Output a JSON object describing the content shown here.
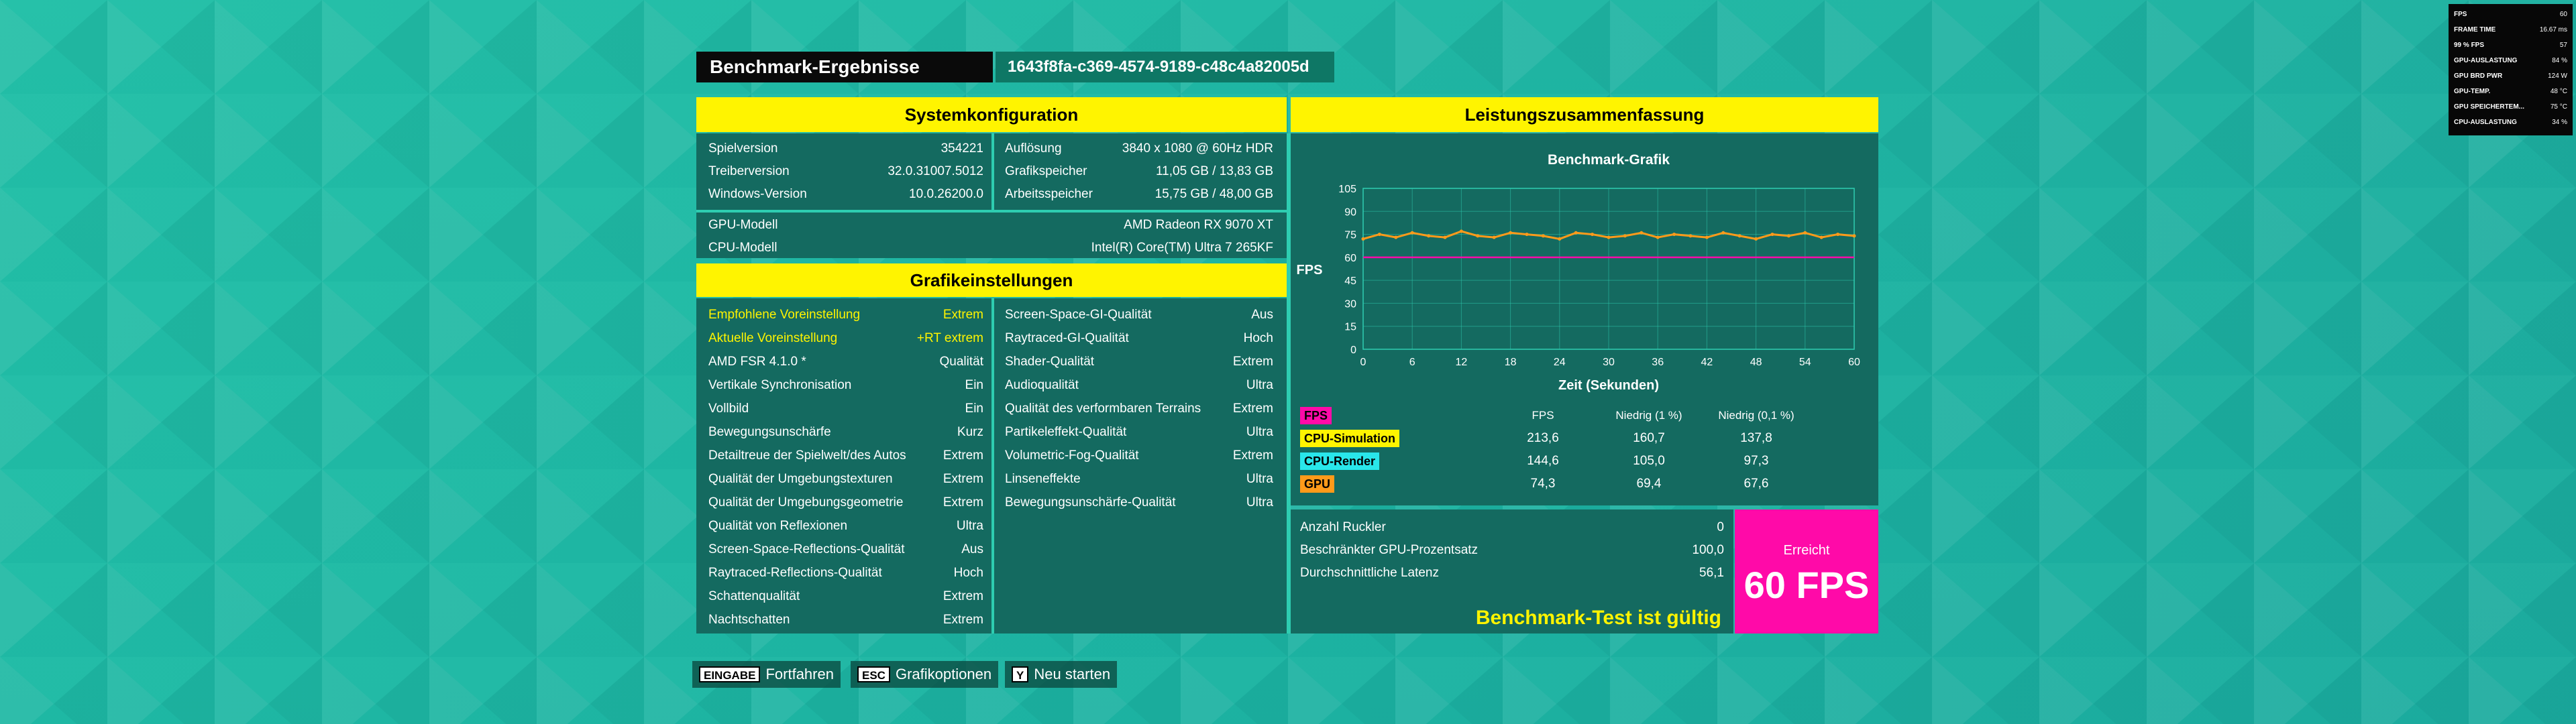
{
  "header": {
    "title": "Benchmark-Ergebnisse",
    "guid": "1643f8fa-c369-4574-9189-c48c4a82005d"
  },
  "system": {
    "heading": "Systemkonfiguration",
    "left": [
      {
        "label": "Spielversion",
        "value": "354221"
      },
      {
        "label": "Treiberversion",
        "value": "32.0.31007.5012"
      },
      {
        "label": "Windows-Version",
        "value": "10.0.26200.0"
      }
    ],
    "right": [
      {
        "label": "Auflösung",
        "value": "3840 x 1080 @ 60Hz HDR"
      },
      {
        "label": "Grafikspeicher",
        "value": "11,05 GB / 13,83 GB"
      },
      {
        "label": "Arbeitsspeicher",
        "value": "15,75 GB / 48,00 GB"
      }
    ],
    "full": [
      {
        "label": "GPU-Modell",
        "value": "AMD Radeon RX 9070 XT"
      },
      {
        "label": "CPU-Modell",
        "value": "Intel(R) Core(TM) Ultra 7 265KF"
      }
    ]
  },
  "graphics": {
    "heading": "Grafikeinstellungen",
    "left": [
      {
        "label": "Empfohlene Voreinstellung",
        "value": "Extrem",
        "highlight": true
      },
      {
        "label": "Aktuelle Voreinstellung",
        "value": "+RT extrem",
        "highlight": true
      },
      {
        "label": "AMD FSR 4.1.0 *",
        "value": "Qualität"
      },
      {
        "label": "Vertikale Synchronisation",
        "value": "Ein"
      },
      {
        "label": "Vollbild",
        "value": "Ein"
      },
      {
        "label": "Bewegungsunschärfe",
        "value": "Kurz"
      },
      {
        "label": "Detailtreue der Spielwelt/des Autos",
        "value": "Extrem"
      },
      {
        "label": "Qualität der Umgebungstexturen",
        "value": "Extrem"
      },
      {
        "label": "Qualität der Umgebungsgeometrie",
        "value": "Extrem"
      },
      {
        "label": "Qualität von Reflexionen",
        "value": "Ultra"
      },
      {
        "label": "Screen-Space-Reflections-Qualität",
        "value": "Aus"
      },
      {
        "label": "Raytraced-Reflections-Qualität",
        "value": "Hoch"
      },
      {
        "label": "Schattenqualität",
        "value": "Extrem"
      },
      {
        "label": "Nachtschatten",
        "value": "Extrem"
      }
    ],
    "right": [
      {
        "label": "Screen-Space-GI-Qualität",
        "value": "Aus"
      },
      {
        "label": "Raytraced-GI-Qualität",
        "value": "Hoch"
      },
      {
        "label": "Shader-Qualität",
        "value": "Extrem"
      },
      {
        "label": "Audioqualität",
        "value": "Ultra"
      },
      {
        "label": "Qualität des verformbaren Terrains",
        "value": "Extrem"
      },
      {
        "label": "Partikeleffekt-Qualität",
        "value": "Ultra"
      },
      {
        "label": "Volumetric-Fog-Qualität",
        "value": "Extrem"
      },
      {
        "label": "Linseneffekte",
        "value": "Ultra"
      },
      {
        "label": "Bewegungsunschärfe-Qualität",
        "value": "Ultra"
      }
    ]
  },
  "performance": {
    "heading": "Leistungszusammenfassung",
    "stats_headers": [
      "FPS",
      "Niedrig (1 %)",
      "Niedrig (0,1 %)"
    ],
    "stats": [
      {
        "label": "FPS",
        "color": "#ff0aa8",
        "values": [
          "",
          "",
          ""
        ]
      },
      {
        "label": "CPU-Simulation",
        "color": "#fff400",
        "values": [
          "213,6",
          "160,7",
          "137,8"
        ]
      },
      {
        "label": "CPU-Render",
        "color": "#29e6ea",
        "values": [
          "144,6",
          "105,0",
          "97,3"
        ]
      },
      {
        "label": "GPU",
        "color": "#ff9a1a",
        "values": [
          "74,3",
          "69,4",
          "67,6"
        ]
      }
    ],
    "summary": [
      {
        "label": "Anzahl Ruckler",
        "value": "0"
      },
      {
        "label": "Beschränkter GPU-Prozentsatz",
        "value": "100,0"
      },
      {
        "label": "Durchschnittliche Latenz",
        "value": "56,1"
      }
    ],
    "valid_text": "Benchmark-Test ist gültig",
    "achieved_label": "Erreicht",
    "achieved_value": "60 FPS"
  },
  "chart_data": {
    "type": "line",
    "title": "Benchmark-Grafik",
    "xlabel": "Zeit (Sekunden)",
    "ylabel": "FPS",
    "xlim": [
      0,
      60
    ],
    "ylim": [
      0,
      105
    ],
    "xticks": [
      0,
      6,
      12,
      18,
      24,
      30,
      36,
      42,
      48,
      54,
      60
    ],
    "yticks": [
      0,
      15,
      30,
      45,
      60,
      75,
      90,
      105
    ],
    "grid": true,
    "series": [
      {
        "name": "FPS",
        "color": "#ff0aa8",
        "x": [
          0,
          60
        ],
        "y": [
          60,
          60
        ]
      },
      {
        "name": "GPU",
        "color": "#ff9a1a",
        "x": [
          0,
          2,
          4,
          6,
          8,
          10,
          12,
          14,
          16,
          18,
          20,
          22,
          24,
          26,
          28,
          30,
          32,
          34,
          36,
          38,
          40,
          42,
          44,
          46,
          48,
          50,
          52,
          54,
          56,
          58,
          60
        ],
        "y": [
          72,
          75,
          73,
          76,
          74,
          73,
          77,
          74,
          73,
          76,
          75,
          74,
          72,
          76,
          75,
          73,
          74,
          76,
          73,
          75,
          74,
          73,
          76,
          74,
          72,
          75,
          74,
          76,
          73,
          75,
          74
        ]
      }
    ]
  },
  "buttons": [
    {
      "key": "EINGABE",
      "label": "Fortfahren"
    },
    {
      "key": "ESC",
      "label": "Grafikoptionen"
    },
    {
      "key": "Y",
      "label": "Neu starten"
    }
  ],
  "overlay": [
    {
      "label": "FPS",
      "value": "60"
    },
    {
      "label": "FRAME TIME",
      "value": "16.67 ms"
    },
    {
      "label": "99 % FPS",
      "value": "57"
    },
    {
      "label": "GPU-AUSLASTUNG",
      "value": "84 %"
    },
    {
      "label": "GPU BRD PWR",
      "value": "124 W"
    },
    {
      "label": "GPU-TEMP.",
      "value": "48 °C"
    },
    {
      "label": "GPU SPEICHERTEM...",
      "value": "75 °C"
    },
    {
      "label": "CPU-AUSLASTUNG",
      "value": "34 %"
    }
  ]
}
